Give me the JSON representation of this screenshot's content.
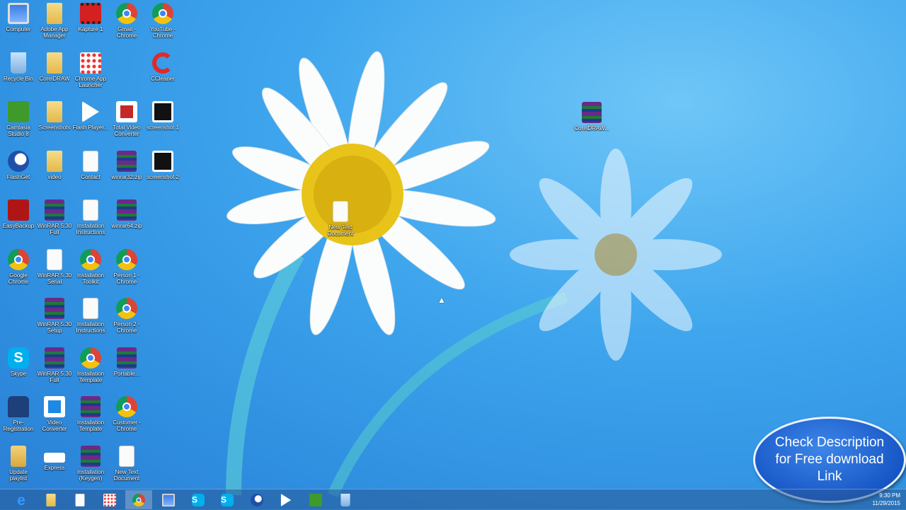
{
  "desktop_icons": [
    {
      "label": "Computer",
      "type": "computer"
    },
    {
      "label": "Adobe App Manager",
      "type": "folder"
    },
    {
      "label": "Kapture 1",
      "type": "video"
    },
    {
      "label": "Gmail - Chrome",
      "type": "chrome"
    },
    {
      "label": "YouTube - Chrome",
      "type": "chrome"
    },
    {
      "label": "Recycle Bin",
      "type": "bin"
    },
    {
      "label": "CorelDRAW",
      "type": "folder"
    },
    {
      "label": "Chrome App Launcher",
      "type": "apps"
    },
    {
      "label": "CCleaner",
      "type": "cc"
    },
    {
      "label": "Camtasia Studio 8",
      "type": "camtasia"
    },
    {
      "label": "Screenshots",
      "type": "folder"
    },
    {
      "label": "Flash Player...",
      "type": "play"
    },
    {
      "label": "Total Video Converter",
      "type": "pdf"
    },
    {
      "label": "screenshot 1",
      "type": "image"
    },
    {
      "label": "FlashGet",
      "type": "eagle"
    },
    {
      "label": "video",
      "type": "folder"
    },
    {
      "label": "Contact",
      "type": "file"
    },
    {
      "label": "winrar32.zip",
      "type": "rar"
    },
    {
      "label": "screenshot 2",
      "type": "image"
    },
    {
      "label": "EasyBackup",
      "type": "red"
    },
    {
      "label": "WinRAR 5.30 Full",
      "type": "rar"
    },
    {
      "label": "Installation Instructions",
      "type": "file"
    },
    {
      "label": "winrar64.zip",
      "type": "rar"
    },
    {
      "label": "Google Chrome",
      "type": "chrome"
    },
    {
      "label": "WinRAR 5.30 Serial",
      "type": "file"
    },
    {
      "label": "Installation Toolkit",
      "type": "chrome"
    },
    {
      "label": "Person 1 - Chrome",
      "type": "chrome"
    },
    {
      "label": "WinRAR 5.30 Setup",
      "type": "rar"
    },
    {
      "label": "Installation Instructions",
      "type": "file"
    },
    {
      "label": "Person 2 - Chrome",
      "type": "chrome"
    },
    {
      "label": "Skype",
      "type": "skype"
    },
    {
      "label": "WinRAR 5.30 Full",
      "type": "rar"
    },
    {
      "label": "Installation Template",
      "type": "chrome"
    },
    {
      "label": "Portable...",
      "type": "rar"
    },
    {
      "label": "Pre-Registration",
      "type": "shirt"
    },
    {
      "label": "Video Converter",
      "type": "gear"
    },
    {
      "label": "Installation Template",
      "type": "rar"
    },
    {
      "label": "Customer - Chrome",
      "type": "chrome"
    },
    {
      "label": "Update playlist",
      "type": "music"
    },
    {
      "label": "Express",
      "type": "blank"
    },
    {
      "label": "Installation (Keygen)",
      "type": "rar"
    },
    {
      "label": "New Text Document",
      "type": "file"
    },
    {
      "label": "New Text Document",
      "type": "file"
    },
    {
      "label": "CorelDRAW...",
      "type": "rar"
    }
  ],
  "taskbar": {
    "items": [
      {
        "name": "internet-explorer",
        "type": "ie"
      },
      {
        "name": "file-explorer",
        "type": "folder"
      },
      {
        "name": "document",
        "type": "file"
      },
      {
        "name": "app-launcher",
        "type": "apps"
      },
      {
        "name": "chrome",
        "type": "chrome",
        "active": true
      },
      {
        "name": "network",
        "type": "computer"
      },
      {
        "name": "skype",
        "type": "skype"
      },
      {
        "name": "skype-2",
        "type": "skype"
      },
      {
        "name": "flashget",
        "type": "eagle"
      },
      {
        "name": "media-player",
        "type": "play"
      },
      {
        "name": "camtasia",
        "type": "camtasia"
      },
      {
        "name": "recycle",
        "type": "bin"
      }
    ],
    "clock": {
      "time": "9:30 PM",
      "date": "11/29/2015"
    }
  },
  "promo": {
    "line1": "Check Description",
    "line2": "for Free download",
    "line3": "Link"
  }
}
